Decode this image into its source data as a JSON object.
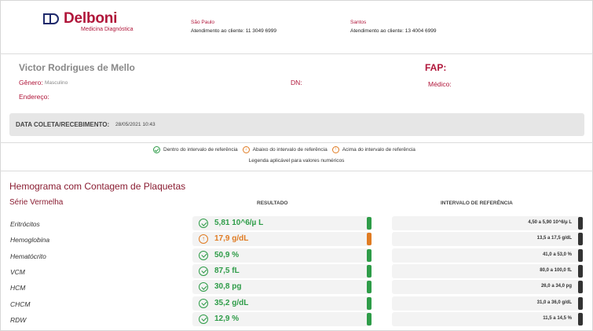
{
  "header": {
    "brand": "Delboni",
    "brand_sub": "Medicina Diagnóstica",
    "contacts": [
      {
        "city": "São Paulo",
        "phone": "Atendimento ao cliente: 11 3049 6999"
      },
      {
        "city": "Santos",
        "phone": "Atendimento ao cliente: 13 4004 6999"
      }
    ]
  },
  "patient": {
    "name": "Victor Rodrigues de Mello",
    "fap_label": "FAP:",
    "gender_label": "Gênero:",
    "gender_value": "Masculino",
    "dn_label": "DN:",
    "doctor_label": "Médico:",
    "address_label": "Endereço:",
    "collection_label": "DATA COLETA/RECEBIMENTO:",
    "collection_value": "28/05/2021 10:43"
  },
  "legend": {
    "within": "Dentro do intervalo de referência",
    "below": "Abaixo do intervalo de referência",
    "above": "Acima do intervalo de referência",
    "note": "Legenda aplicável para valores numéricos"
  },
  "section": {
    "title": "Hemograma com Contagem de Plaquetas",
    "subtitle": "Série Vermelha",
    "col_result": "RESULTADO",
    "col_reference": "INTERVALO DE REFERÊNCIA"
  },
  "colors": {
    "ok": "#2e9c48",
    "high": "#e07b22",
    "brand": "#b0163a"
  },
  "rows": [
    {
      "name": "Eritrócitos",
      "value": "5,81 10^6/µ L",
      "status": "ok",
      "reference": "4,50 a 5,90 10^6/µ L"
    },
    {
      "name": "Hemoglobina",
      "value": "17,9 g/dL",
      "status": "high",
      "reference": "13,5 a 17,5 g/dL"
    },
    {
      "name": "Hematócrito",
      "value": "50,9 %",
      "status": "ok",
      "reference": "41,0 a 53,0 %"
    },
    {
      "name": "VCM",
      "value": "87,5 fL",
      "status": "ok",
      "reference": "80,0 a 100,0 fL"
    },
    {
      "name": "HCM",
      "value": "30,8 pg",
      "status": "ok",
      "reference": "26,0 a 34,0 pg"
    },
    {
      "name": "CHCM",
      "value": "35,2 g/dL",
      "status": "ok",
      "reference": "31,0 a 36,0 g/dL"
    },
    {
      "name": "RDW",
      "value": "12,9 %",
      "status": "ok",
      "reference": "11,5 a 14,5 %"
    }
  ]
}
